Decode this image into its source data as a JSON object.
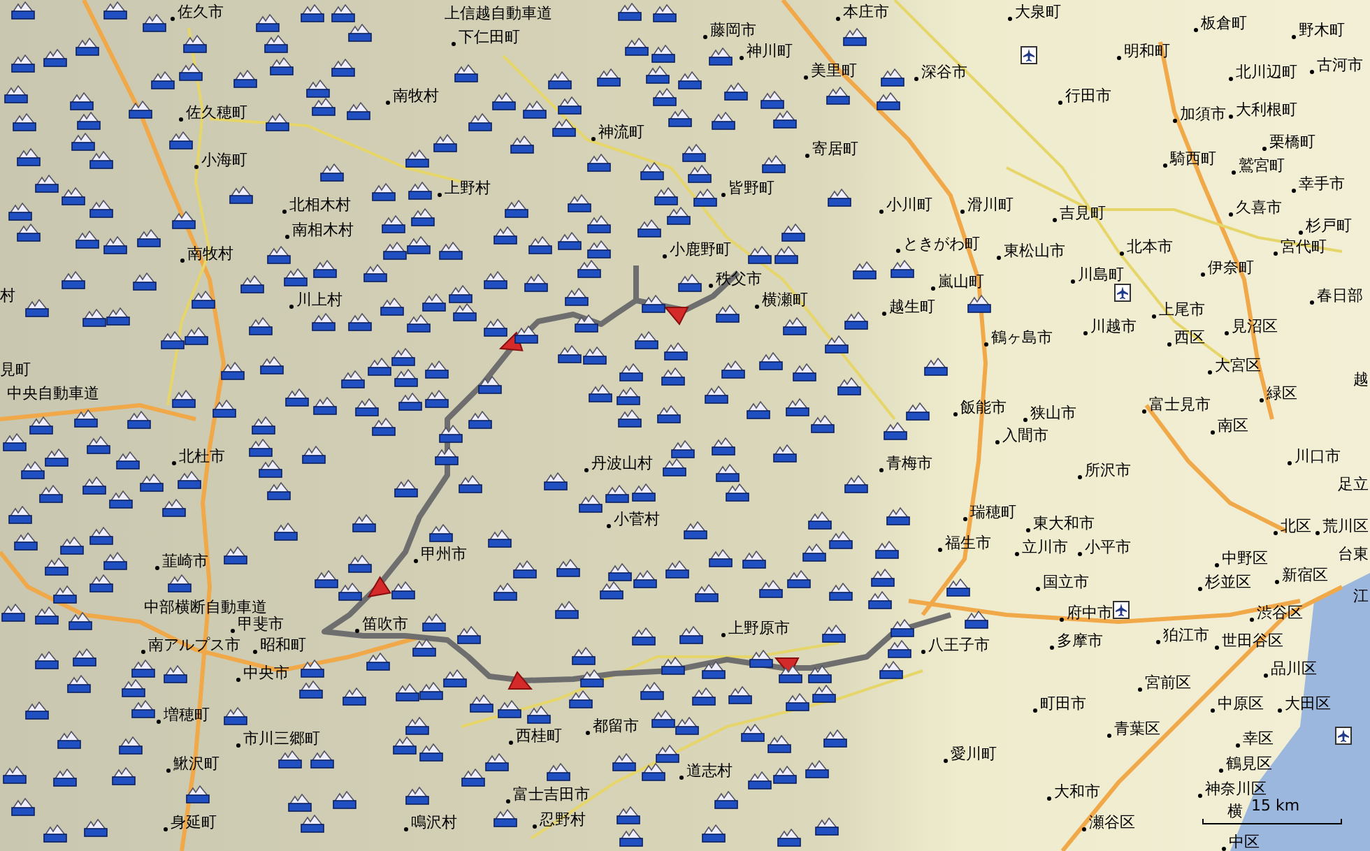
{
  "map": {
    "places": [
      {
        "name": "佐久市",
        "kind": "place"
      },
      {
        "name": "佐久穂町",
        "kind": "place"
      },
      {
        "name": "小海町",
        "kind": "place"
      },
      {
        "name": "北相木村",
        "kind": "place"
      },
      {
        "name": "南相木村",
        "kind": "place"
      },
      {
        "name": "南牧村",
        "kind": "place"
      },
      {
        "name": "川上村",
        "kind": "place"
      },
      {
        "name": "南牧村",
        "kind": "place"
      },
      {
        "name": "上信越自動車道",
        "kind": "road"
      },
      {
        "name": "下仁田町",
        "kind": "place"
      },
      {
        "name": "神流町",
        "kind": "place"
      },
      {
        "name": "上野村",
        "kind": "place"
      },
      {
        "name": "藤岡市",
        "kind": "place"
      },
      {
        "name": "神川町",
        "kind": "place"
      },
      {
        "name": "本庄市",
        "kind": "place"
      },
      {
        "name": "美里町",
        "kind": "place"
      },
      {
        "name": "寄居町",
        "kind": "place"
      },
      {
        "name": "皆野町",
        "kind": "place"
      },
      {
        "name": "小鹿野町",
        "kind": "place"
      },
      {
        "name": "秩父市",
        "kind": "place"
      },
      {
        "name": "横瀬町",
        "kind": "place"
      },
      {
        "name": "小川町",
        "kind": "place"
      },
      {
        "name": "ときがわ町",
        "kind": "place"
      },
      {
        "name": "滑川町",
        "kind": "place"
      },
      {
        "name": "東松山市",
        "kind": "place"
      },
      {
        "name": "嵐山町",
        "kind": "place"
      },
      {
        "name": "越生町",
        "kind": "place"
      },
      {
        "name": "吉見町",
        "kind": "place"
      },
      {
        "name": "北本市",
        "kind": "place"
      },
      {
        "name": "川島町",
        "kind": "place"
      },
      {
        "name": "川越市",
        "kind": "place"
      },
      {
        "name": "上尾市",
        "kind": "place"
      },
      {
        "name": "西区",
        "kind": "place"
      },
      {
        "name": "見沼区",
        "kind": "place"
      },
      {
        "name": "大宮区",
        "kind": "place"
      },
      {
        "name": "緑区",
        "kind": "place"
      },
      {
        "name": "富士見市",
        "kind": "place"
      },
      {
        "name": "鶴ヶ島市",
        "kind": "place"
      },
      {
        "name": "飯能市",
        "kind": "place"
      },
      {
        "name": "狭山市",
        "kind": "place"
      },
      {
        "name": "大泉町",
        "kind": "place"
      },
      {
        "name": "明和町",
        "kind": "place"
      },
      {
        "name": "板倉町",
        "kind": "place"
      },
      {
        "name": "野木町",
        "kind": "place"
      },
      {
        "name": "深谷市",
        "kind": "place"
      },
      {
        "name": "行田市",
        "kind": "place"
      },
      {
        "name": "北川辺町",
        "kind": "place"
      },
      {
        "name": "古河市",
        "kind": "place"
      },
      {
        "name": "加須市",
        "kind": "place"
      },
      {
        "name": "大利根町",
        "kind": "place"
      },
      {
        "name": "栗橋町",
        "kind": "place"
      },
      {
        "name": "騎西町",
        "kind": "place"
      },
      {
        "name": "鷲宮町",
        "kind": "place"
      },
      {
        "name": "幸手市",
        "kind": "place"
      },
      {
        "name": "久喜市",
        "kind": "place"
      },
      {
        "name": "杉戸町",
        "kind": "place"
      },
      {
        "name": "宮代町",
        "kind": "place"
      },
      {
        "name": "伊奈町",
        "kind": "place"
      },
      {
        "name": "春日部",
        "kind": "place"
      },
      {
        "name": "越",
        "kind": "partial"
      },
      {
        "name": "村",
        "kind": "partial"
      },
      {
        "name": "見町",
        "kind": "partial"
      },
      {
        "name": "中央自動車道",
        "kind": "road"
      },
      {
        "name": "北杜市",
        "kind": "place"
      },
      {
        "name": "韮崎市",
        "kind": "place"
      },
      {
        "name": "中部横断自動車道",
        "kind": "road"
      },
      {
        "name": "甲斐市",
        "kind": "place"
      },
      {
        "name": "南アルプス市",
        "kind": "place"
      },
      {
        "name": "昭和町",
        "kind": "place"
      },
      {
        "name": "中央市",
        "kind": "place"
      },
      {
        "name": "増穂町",
        "kind": "place"
      },
      {
        "name": "市川三郷町",
        "kind": "place"
      },
      {
        "name": "鰍沢町",
        "kind": "place"
      },
      {
        "name": "身延町",
        "kind": "place"
      },
      {
        "name": "鳴沢村",
        "kind": "place"
      },
      {
        "name": "笛吹市",
        "kind": "place"
      },
      {
        "name": "甲州市",
        "kind": "place"
      },
      {
        "name": "丹波山村",
        "kind": "place"
      },
      {
        "name": "小菅村",
        "kind": "place"
      },
      {
        "name": "上野原市",
        "kind": "place"
      },
      {
        "name": "都留市",
        "kind": "place"
      },
      {
        "name": "西桂町",
        "kind": "place"
      },
      {
        "name": "道志村",
        "kind": "place"
      },
      {
        "name": "富士吉田市",
        "kind": "place"
      },
      {
        "name": "忍野村",
        "kind": "place"
      },
      {
        "name": "青梅市",
        "kind": "place"
      },
      {
        "name": "入間市",
        "kind": "place"
      },
      {
        "name": "所沢市",
        "kind": "place"
      },
      {
        "name": "瑞穂町",
        "kind": "place"
      },
      {
        "name": "東大和市",
        "kind": "place"
      },
      {
        "name": "福生市",
        "kind": "place"
      },
      {
        "name": "立川市",
        "kind": "place"
      },
      {
        "name": "小平市",
        "kind": "place"
      },
      {
        "name": "国立市",
        "kind": "place"
      },
      {
        "name": "府中市",
        "kind": "place"
      },
      {
        "name": "八王子市",
        "kind": "place"
      },
      {
        "name": "多摩市",
        "kind": "place"
      },
      {
        "name": "中野区",
        "kind": "place"
      },
      {
        "name": "杉並区",
        "kind": "place"
      },
      {
        "name": "狛江市",
        "kind": "place"
      },
      {
        "name": "世田谷区",
        "kind": "place"
      },
      {
        "name": "新宿区",
        "kind": "place"
      },
      {
        "name": "渋谷区",
        "kind": "place"
      },
      {
        "name": "北区",
        "kind": "place"
      },
      {
        "name": "荒川区",
        "kind": "place"
      },
      {
        "name": "川口市",
        "kind": "place"
      },
      {
        "name": "南区",
        "kind": "place"
      },
      {
        "name": "足立",
        "kind": "partial"
      },
      {
        "name": "台東",
        "kind": "partial"
      },
      {
        "name": "江",
        "kind": "partial"
      },
      {
        "name": "品川区",
        "kind": "place"
      },
      {
        "name": "宮前区",
        "kind": "place"
      },
      {
        "name": "町田市",
        "kind": "place"
      },
      {
        "name": "中原区",
        "kind": "place"
      },
      {
        "name": "大田区",
        "kind": "place"
      },
      {
        "name": "青葉区",
        "kind": "place"
      },
      {
        "name": "幸区",
        "kind": "place"
      },
      {
        "name": "愛川町",
        "kind": "place"
      },
      {
        "name": "鶴見区",
        "kind": "place"
      },
      {
        "name": "大和市",
        "kind": "place"
      },
      {
        "name": "神奈川区",
        "kind": "place"
      },
      {
        "name": "瀬谷区",
        "kind": "place"
      },
      {
        "name": "横",
        "kind": "partial"
      },
      {
        "name": "中区",
        "kind": "place"
      }
    ],
    "scale_bar": {
      "label": "15 km"
    }
  }
}
